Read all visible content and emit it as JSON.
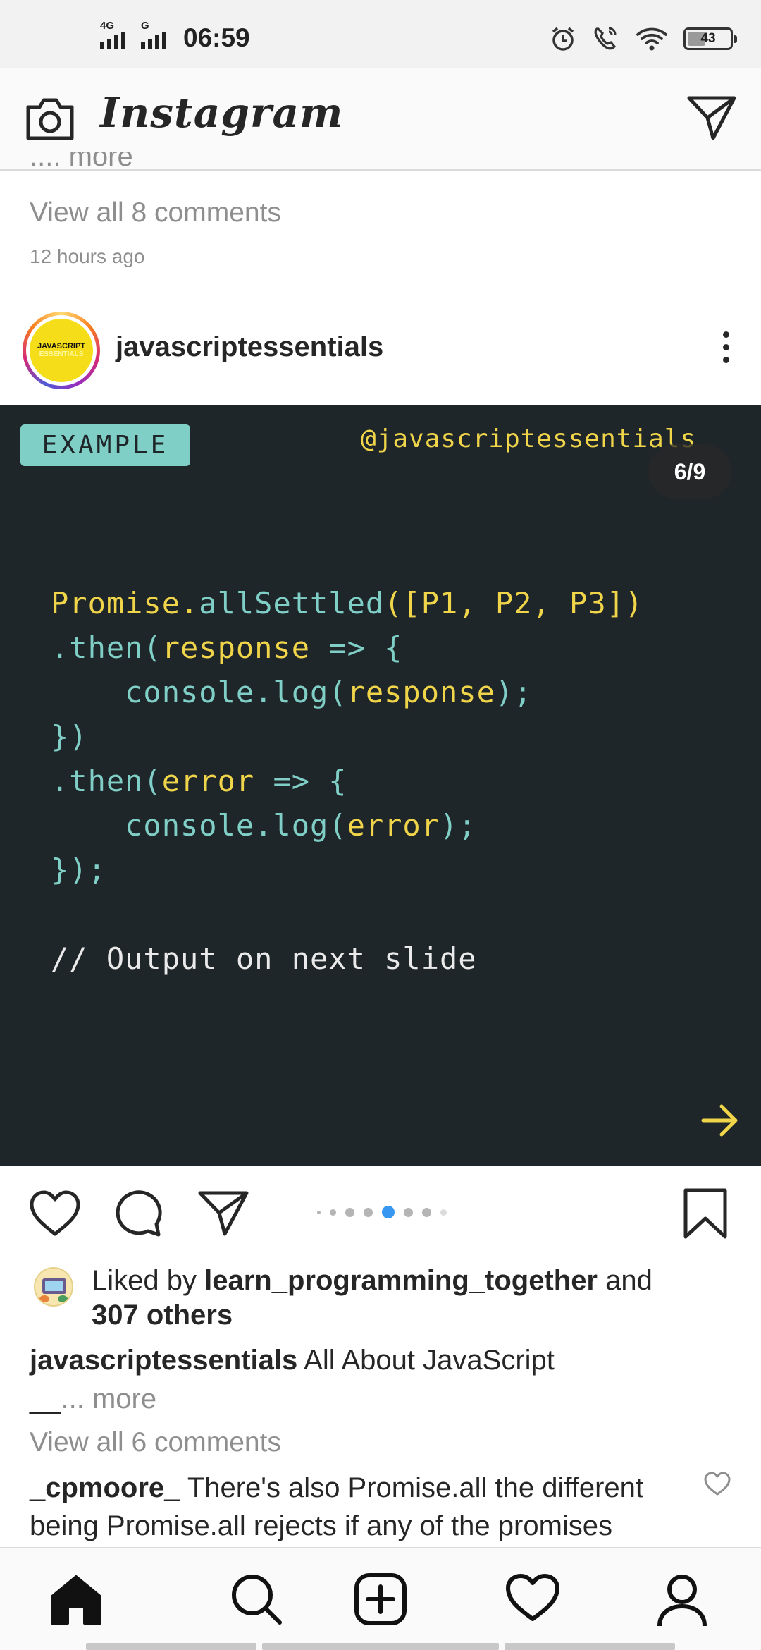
{
  "status_bar": {
    "network_1": "4G",
    "network_2": "G",
    "time": "06:59",
    "battery": "43",
    "battery_level": 0.43,
    "icons": [
      "alarm-icon",
      "wifi-call-icon",
      "wifi-icon",
      "battery-icon"
    ]
  },
  "header": {
    "app_name": "Instagram",
    "icons": [
      "camera-icon",
      "direct-message-icon"
    ]
  },
  "previous_post": {
    "more_text": ".... more",
    "view_comments": "View all 8 comments",
    "time_ago": "12 hours ago"
  },
  "post": {
    "username": "javascriptessentials",
    "avatar_text_1": "JAVASCRIPT",
    "avatar_text_2": "ESSENTIALS",
    "slide": {
      "tag": "EXAMPLE",
      "handle": "@javascriptessentials",
      "counter": "6/9",
      "current_index": 4,
      "dot_count": 8,
      "code_lines": [
        [
          {
            "t": "Promise.",
            "c": "y"
          },
          {
            "t": "allSettled",
            "c": "t"
          },
          {
            "t": "([P1, P2, P3])",
            "c": "y"
          }
        ],
        [
          {
            "t": ".then(",
            "c": "t"
          },
          {
            "t": "response ",
            "c": "y"
          },
          {
            "t": "=> {",
            "c": "t"
          }
        ],
        [
          {
            "t": "    console.log(",
            "c": "t"
          },
          {
            "t": "response",
            "c": "y"
          },
          {
            "t": ");",
            "c": "t"
          }
        ],
        [
          {
            "t": "})",
            "c": "t"
          }
        ],
        [
          {
            "t": ".then(",
            "c": "t"
          },
          {
            "t": "error ",
            "c": "y"
          },
          {
            "t": "=> {",
            "c": "t"
          }
        ],
        [
          {
            "t": "    console.log(",
            "c": "t"
          },
          {
            "t": "error",
            "c": "y"
          },
          {
            "t": ");",
            "c": "t"
          }
        ],
        [
          {
            "t": "});",
            "c": "t"
          }
        ],
        [
          {
            "t": "",
            "c": "w"
          }
        ],
        [
          {
            "t": "// Output on next slide",
            "c": "w"
          }
        ]
      ]
    },
    "likes": {
      "prefix": "Liked by",
      "first_liker": "learn_programming_together",
      "connector": "and",
      "others": "307 others"
    },
    "caption": {
      "username": "javascriptessentials",
      "text": "All About JavaScript",
      "second_line": "__",
      "more": "... more"
    },
    "view_comments": "View all 6 comments",
    "comment": {
      "username": "_cpmoore_",
      "text": "There's also Promise.all the different being Promise.all rejects if any of the promises"
    }
  },
  "bottom_nav": [
    "home-icon",
    "search-icon",
    "new-post-icon",
    "activity-icon",
    "profile-icon"
  ],
  "colors": {
    "slide_bg": "#1f2629",
    "code_yellow": "#f0d54a",
    "code_teal": "#7fcfc7",
    "active_dot": "#3897f0",
    "muted_text": "#8e8e8e"
  }
}
